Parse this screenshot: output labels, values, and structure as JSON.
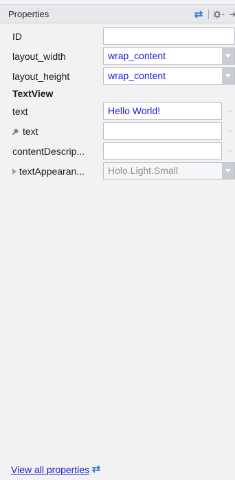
{
  "header": {
    "title": "Properties",
    "icons": [
      "swap-arrows-icon",
      "gear-icon",
      "pin-icon"
    ]
  },
  "properties": {
    "id": {
      "label": "ID",
      "value": ""
    },
    "layout_width": {
      "label": "layout_width",
      "value": "wrap_content"
    },
    "layout_height": {
      "label": "layout_height",
      "value": "wrap_content"
    },
    "section": {
      "label": "TextView"
    },
    "text": {
      "label": "text",
      "value": "Hello World!"
    },
    "tools_text": {
      "label": "text",
      "value": ""
    },
    "content_description": {
      "label": "contentDescrip...",
      "value": ""
    },
    "text_appearance": {
      "label": "textAppearan...",
      "value": "Holo.Light.Small"
    }
  },
  "more_button_label": "...",
  "footer": {
    "link_label": "View all properties"
  },
  "colors": {
    "value_blue": "#1a1adc",
    "link_blue": "#1a1ac8",
    "icon_blue": "#2f6fd6"
  }
}
